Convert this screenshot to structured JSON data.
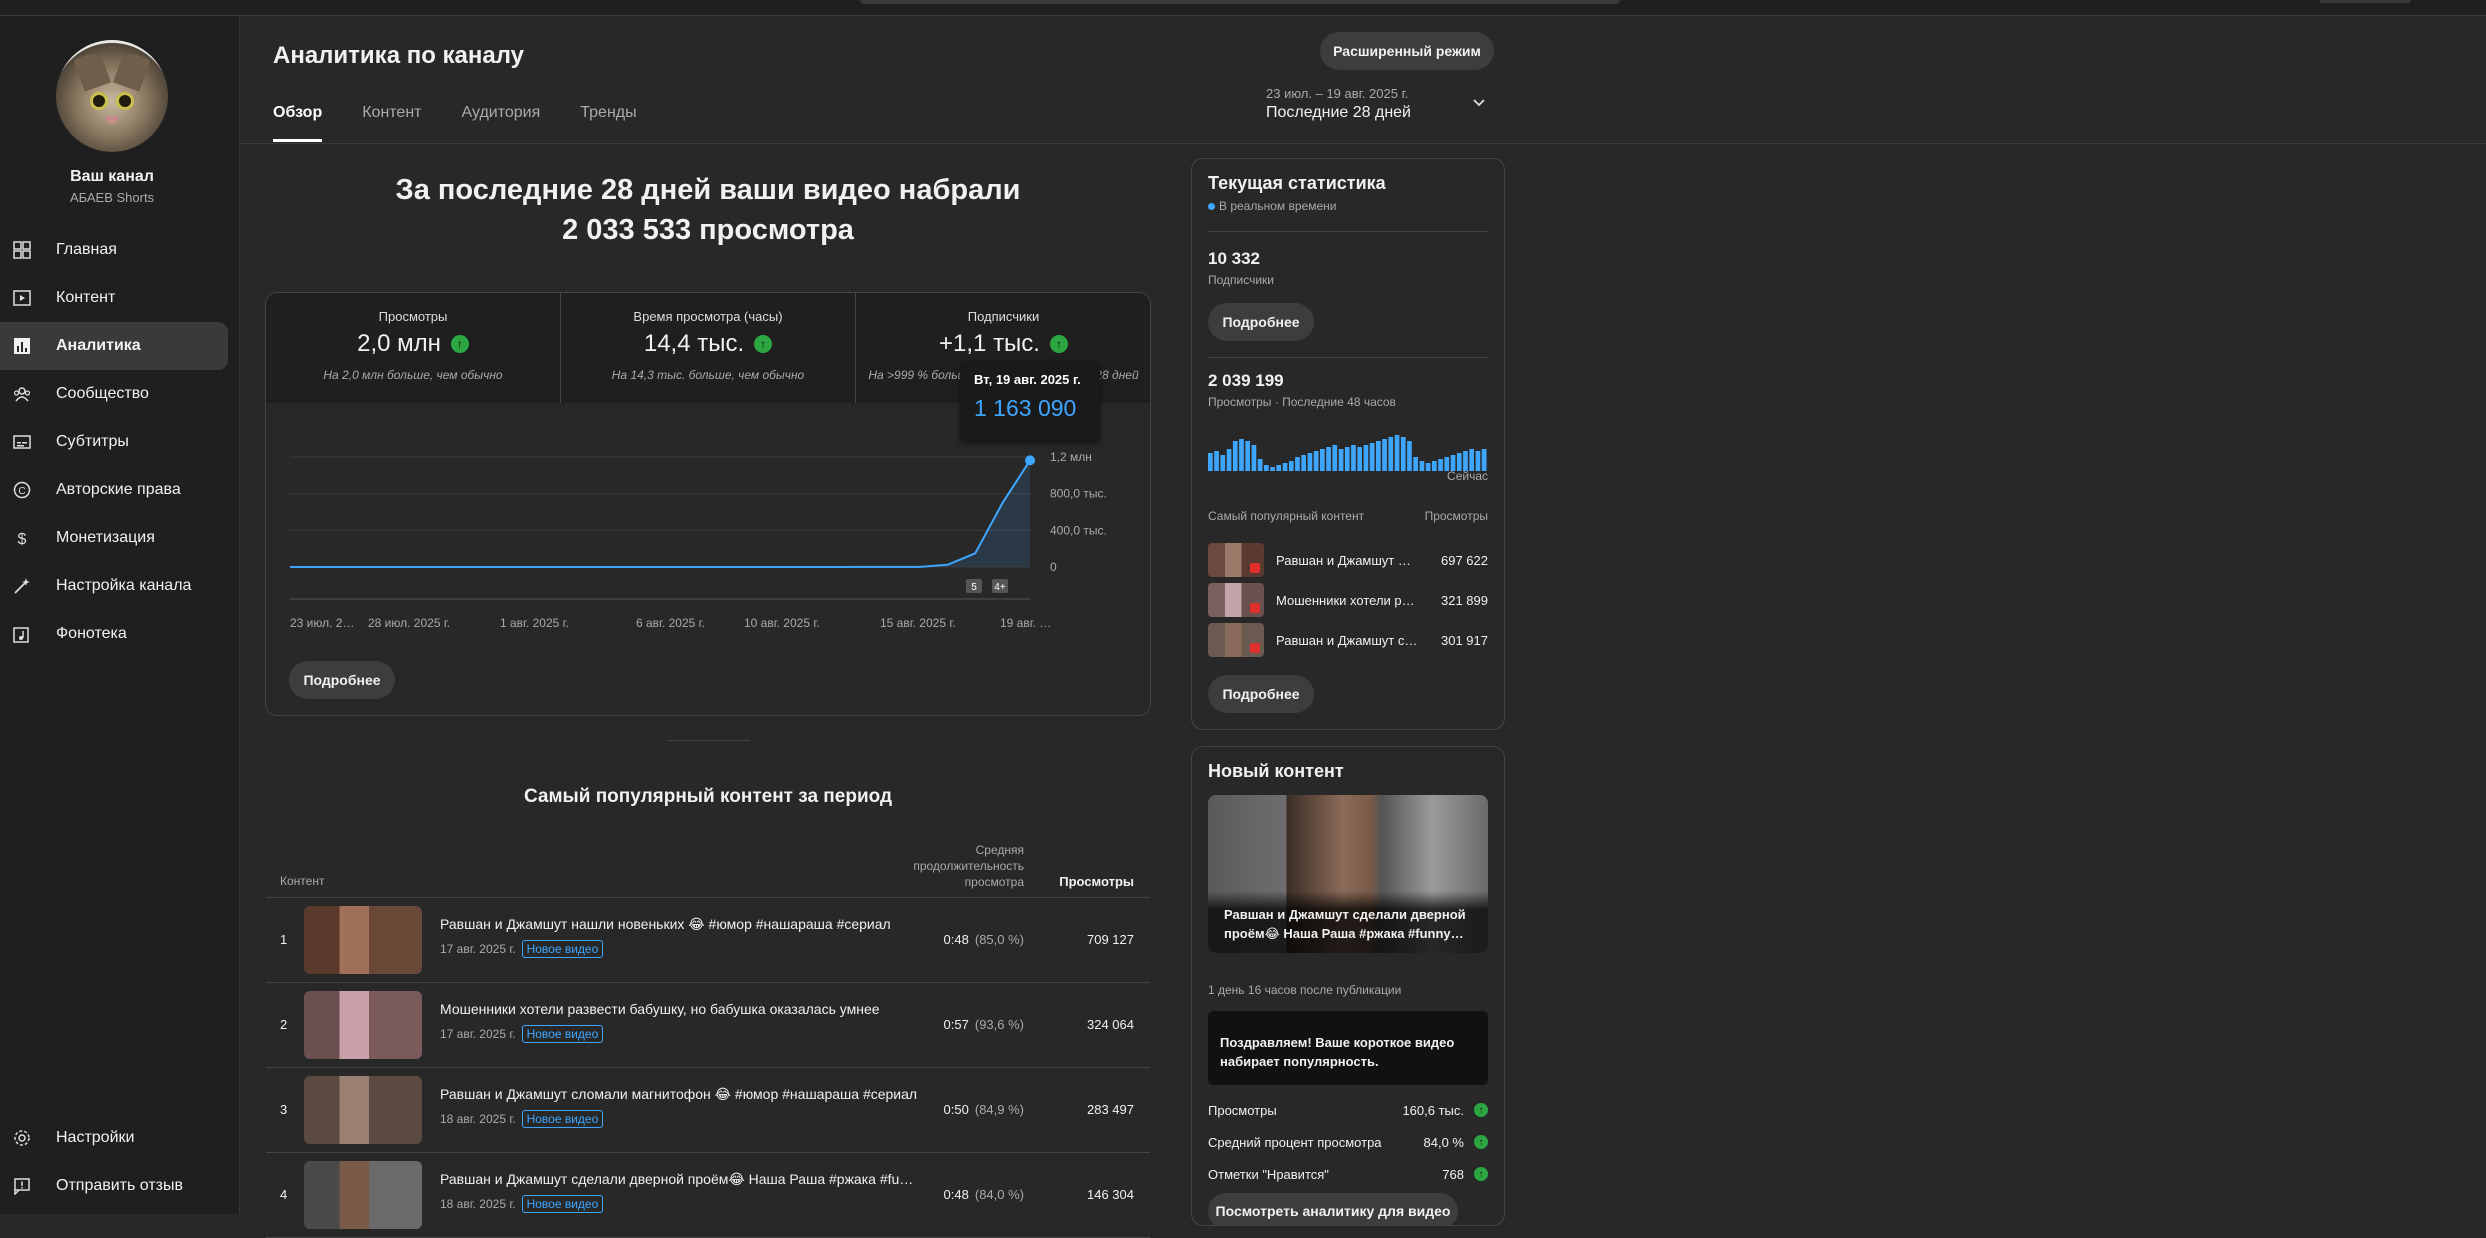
{
  "channel": {
    "name": "Ваш канал",
    "subtitle": "АБАЕВ Shorts"
  },
  "nav": [
    {
      "label": "Главная",
      "icon": "dashboard-icon"
    },
    {
      "label": "Контент",
      "icon": "video-icon"
    },
    {
      "label": "Аналитика",
      "icon": "analytics-icon",
      "active": true
    },
    {
      "label": "Сообщество",
      "icon": "community-icon"
    },
    {
      "label": "Субтитры",
      "icon": "subtitles-icon"
    },
    {
      "label": "Авторские права",
      "icon": "copyright-icon"
    },
    {
      "label": "Монетизация",
      "icon": "monetization-icon"
    },
    {
      "label": "Настройка канала",
      "icon": "magic-wand-icon"
    },
    {
      "label": "Фонотека",
      "icon": "audio-library-icon"
    }
  ],
  "nav_bottom": [
    {
      "label": "Настройки",
      "icon": "gear-icon"
    },
    {
      "label": "Отправить отзыв",
      "icon": "feedback-icon"
    }
  ],
  "header": {
    "title": "Аналитика по каналу",
    "advanced_mode": "Расширенный режим",
    "tabs": [
      "Обзор",
      "Контент",
      "Аудитория",
      "Тренды"
    ],
    "date_range": "23 июл. – 19 авг. 2025 г.",
    "period": "Последние 28 дней"
  },
  "headline": {
    "line1": "За последние 28 дней ваши видео набрали",
    "line2": "2 033 533 просмотра"
  },
  "metrics": [
    {
      "label": "Просмотры",
      "value": "2,0 млн",
      "note": "На 2,0 млн больше, чем обычно"
    },
    {
      "label": "Время просмотра (часы)",
      "value": "14,4 тыс.",
      "note": "На 14,3 тыс. больше, чем обычно"
    },
    {
      "label": "Подписчики",
      "value": "+1,1 тыс.",
      "note": "На >999 % больше, чем за предыдущие 28 дней"
    }
  ],
  "chart_data": {
    "type": "area",
    "x": [
      "23 июл. 2…",
      "28 июл. 2025 г.",
      "1 авг. 2025 г.",
      "6 авг. 2025 г.",
      "10 авг. 2025 г.",
      "15 авг. 2025 г.",
      "19 авг. …"
    ],
    "y_ticks": [
      "1,2 млн",
      "800,0 тыс.",
      "400,0 тыс.",
      "0"
    ],
    "ylim": [
      0,
      1200000
    ],
    "values": [
      200,
      300,
      250,
      400,
      300,
      350,
      400,
      380,
      300,
      420,
      500,
      450,
      380,
      400,
      420,
      460,
      500,
      480,
      400,
      450,
      500,
      600,
      900,
      1500,
      25000,
      150000,
      700000,
      1163090
    ],
    "markers": [
      "5",
      "4+"
    ],
    "color": "#3ea6ff",
    "tooltip": {
      "date": "Вт, 19 авг. 2025 г.",
      "value": "1 163 090"
    }
  },
  "more_label": "Подробнее",
  "top_content": {
    "title": "Самый популярный контент за период",
    "col_content": "Контент",
    "col_duration": "Средняя продолжительность просмотра",
    "col_views": "Просмотры",
    "rows": [
      {
        "rank": "1",
        "title": "Равшан и Джамшут нашли новеньких 😂 #юмор #нашараша #сериал",
        "date": "17 авг. 2025 г.",
        "badge": "Новое видео",
        "dur": "0:48",
        "pct": "(85,0 %)",
        "views": "709 127"
      },
      {
        "rank": "2",
        "title": "Мошенники хотели развести бабушку, но бабушка оказалась умнее",
        "date": "17 авг. 2025 г.",
        "badge": "Новое видео",
        "dur": "0:57",
        "pct": "(93,6 %)",
        "views": "324 064"
      },
      {
        "rank": "3",
        "title": "Равшан и Джамшут сломали магнитофон 😂 #юмор #нашараша #сериал",
        "date": "18 авг. 2025 г.",
        "badge": "Новое видео",
        "dur": "0:50",
        "pct": "(84,9 %)",
        "views": "283 497"
      },
      {
        "rank": "4",
        "title": "Равшан и Джамшут сделали дверной проём😂 Наша Раша #ржака #funny…",
        "date": "18 авг. 2025 г.",
        "badge": "Новое видео",
        "dur": "0:48",
        "pct": "(84,0 %)",
        "views": "146 304"
      }
    ]
  },
  "realtime": {
    "title": "Текущая статистика",
    "live": "В реальном времени",
    "subs_value": "10 332",
    "subs_label": "Подписчики",
    "views_value": "2 039 199",
    "views_label": "Просмотры · Последние 48 часов",
    "now": "Сейчас",
    "spark": [
      18,
      20,
      16,
      22,
      30,
      32,
      30,
      26,
      12,
      6,
      4,
      6,
      8,
      10,
      14,
      16,
      18,
      20,
      22,
      24,
      26,
      22,
      24,
      26,
      24,
      26,
      28,
      30,
      32,
      34,
      36,
      34,
      30,
      14,
      10,
      8,
      10,
      12,
      14,
      16,
      18,
      20,
      22,
      20,
      22
    ],
    "pop_header": "Самый популярный контент",
    "pop_views_header": "Просмотры",
    "pop": [
      {
        "title": "Равшан и Джамшут нашли новеньких",
        "views": "697 622"
      },
      {
        "title": "Мошенники хотели развести бабушку",
        "views": "321 899"
      },
      {
        "title": "Равшан и Джамшут сломали магнитофон",
        "views": "301 917"
      }
    ]
  },
  "new_content": {
    "title": "Новый контент",
    "video_title": "Равшан и Джамшут сделали дверной проём😂 Наша Раша #ржака #funny…",
    "since": "1 день 16 часов после публикации",
    "congrats": "Поздравляем! Ваше короткое видео набирает популярность.",
    "stats": [
      {
        "label": "Просмотры",
        "value": "160,6 тыс."
      },
      {
        "label": "Средний процент просмотра",
        "value": "84,0 %"
      },
      {
        "label": "Отметки \"Нравится\"",
        "value": "768"
      }
    ],
    "button": "Посмотреть аналитику для видео"
  }
}
